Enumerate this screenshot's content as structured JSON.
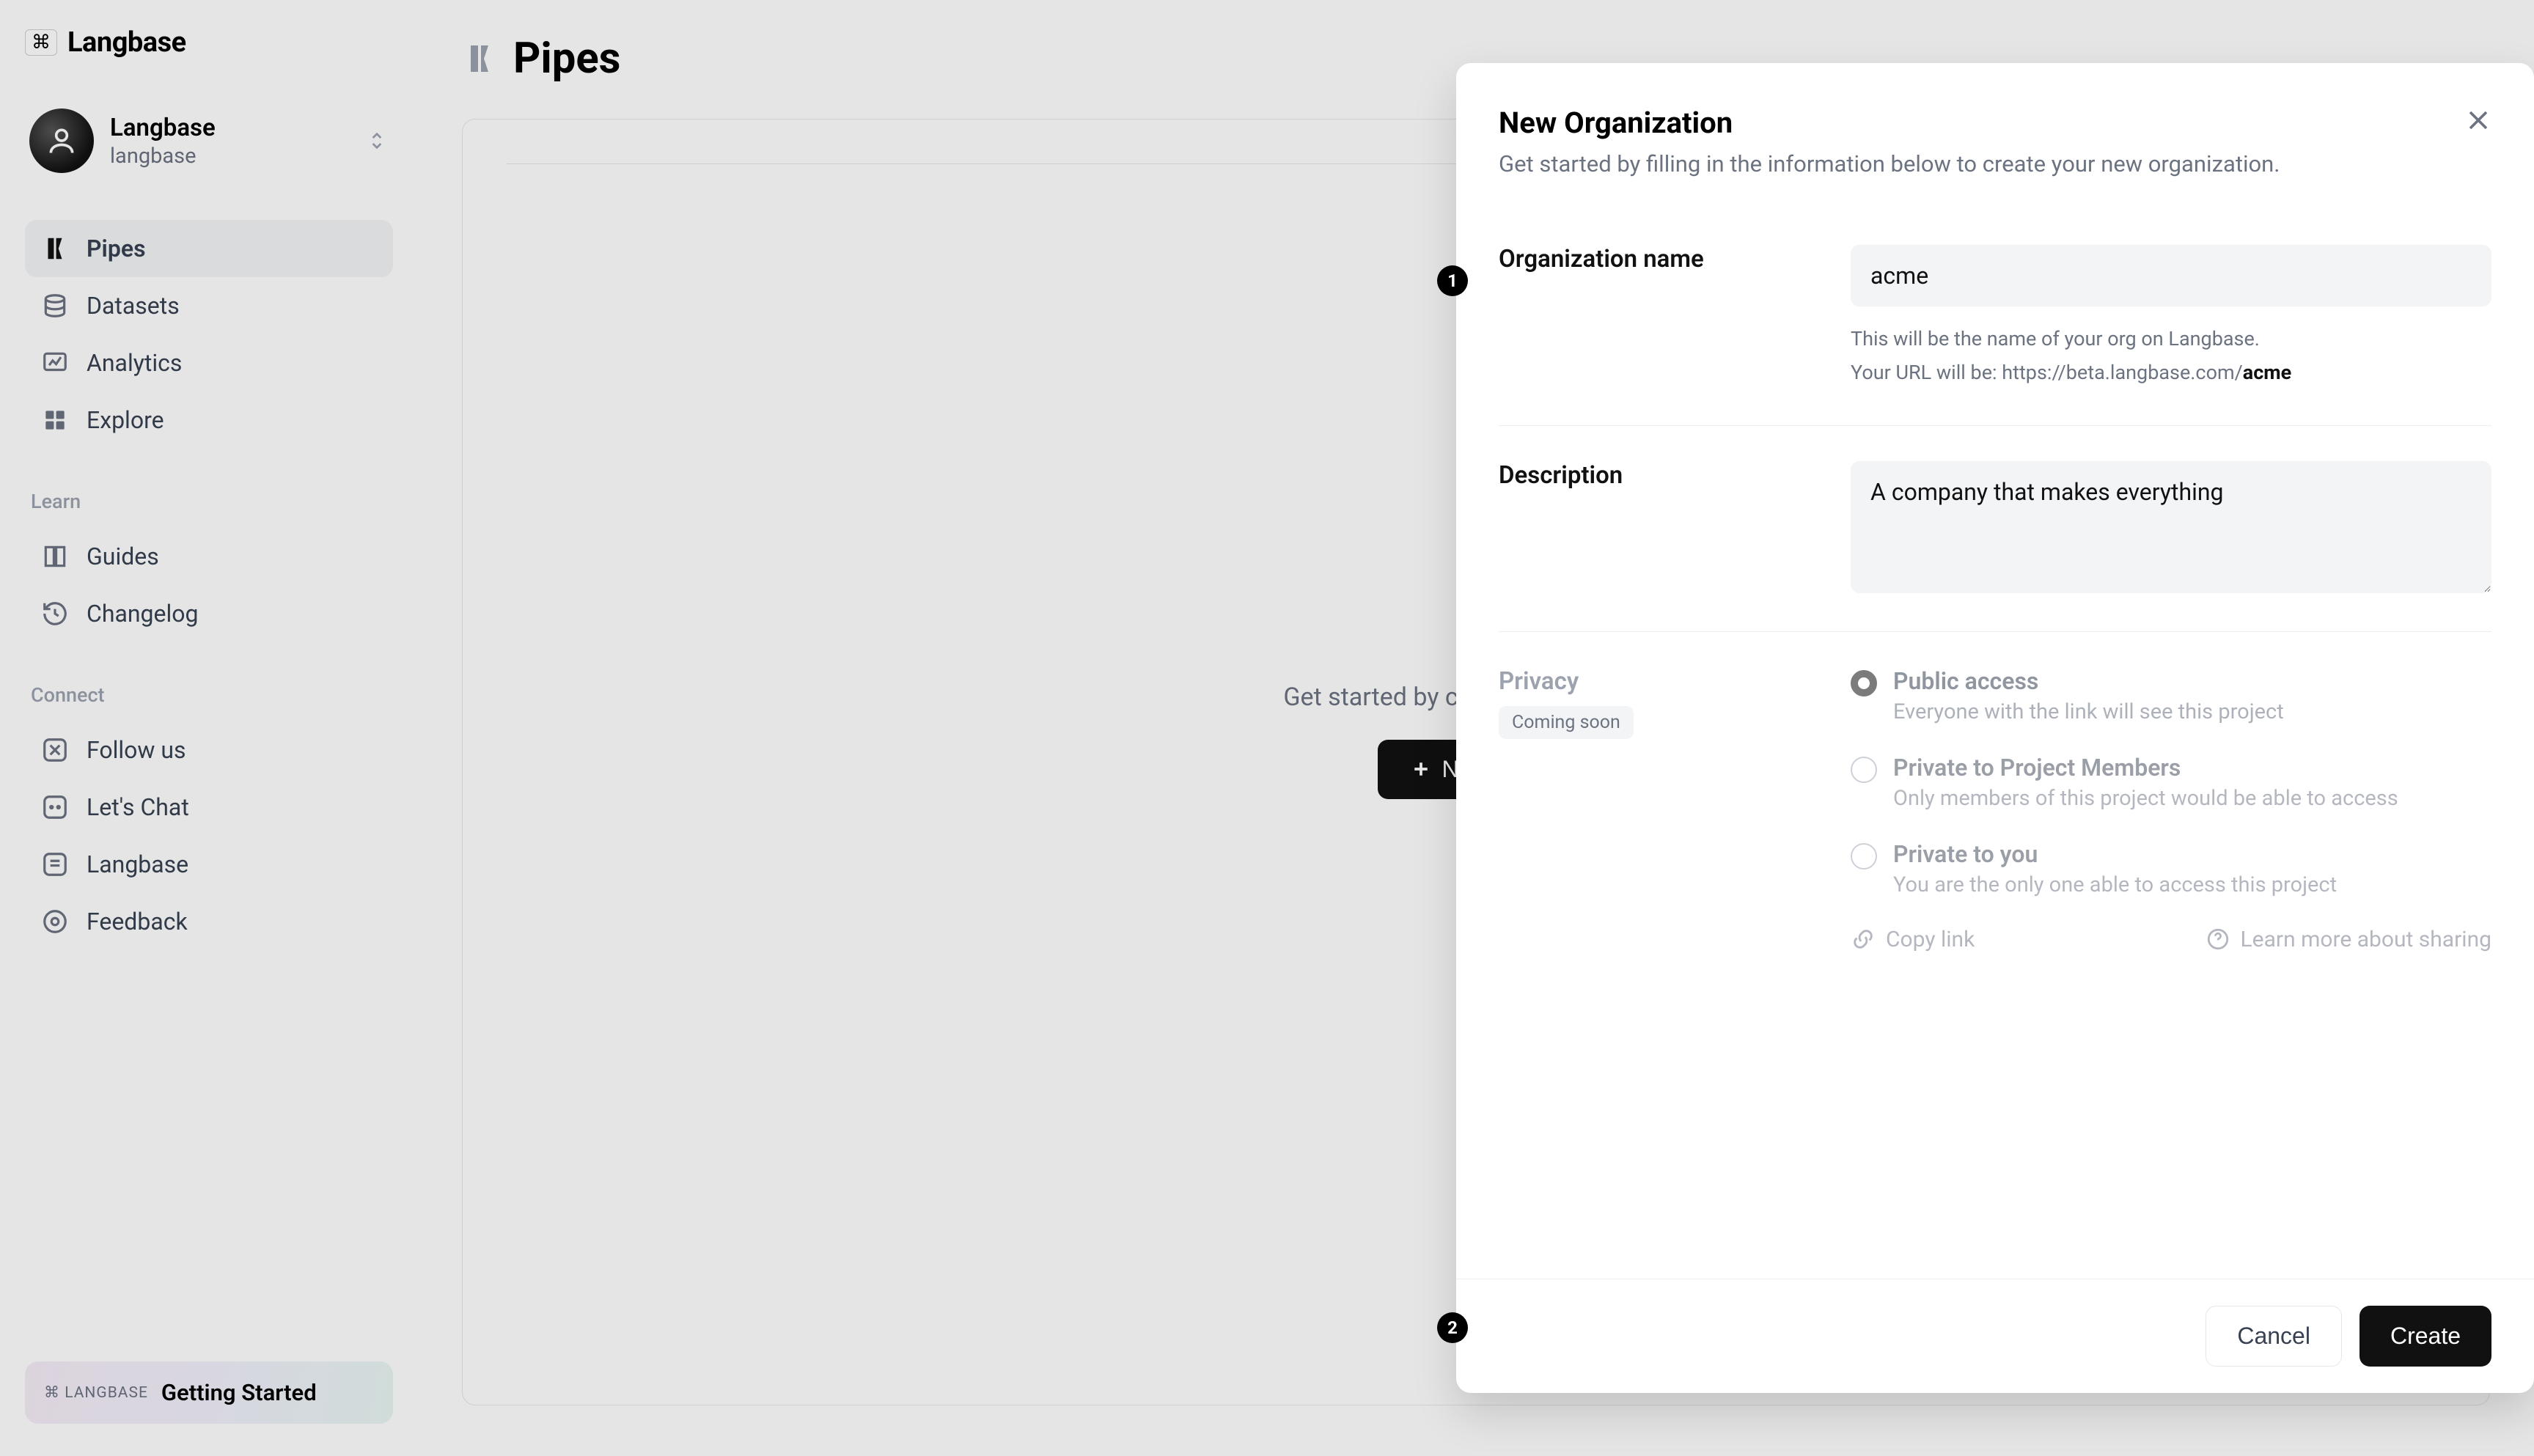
{
  "brand": {
    "symbol": "⌘",
    "name": "Langbase"
  },
  "org": {
    "name": "Langbase",
    "slug": "langbase"
  },
  "nav": {
    "main": [
      {
        "label": "Pipes",
        "active": true
      },
      {
        "label": "Datasets"
      },
      {
        "label": "Analytics"
      },
      {
        "label": "Explore"
      }
    ],
    "learn_heading": "Learn",
    "learn": [
      {
        "label": "Guides"
      },
      {
        "label": "Changelog"
      }
    ],
    "connect_heading": "Connect",
    "connect": [
      {
        "label": "Follow us"
      },
      {
        "label": "Let's Chat"
      },
      {
        "label": "Langbase"
      },
      {
        "label": "Feedback"
      }
    ]
  },
  "getting_started": {
    "badge": "⌘ LANGBASE",
    "text": "Getting Started"
  },
  "page": {
    "title": "Pipes",
    "empty_text": "Get started by creating a new Pipe.",
    "new_pipe_label": "New Pipe"
  },
  "modal": {
    "title": "New Organization",
    "subtitle": "Get started by filling in the information below to create your new organization.",
    "fields": {
      "org_name_label": "Organization name",
      "org_name_value": "acme",
      "org_name_help1": "This will be the name of your org on Langbase.",
      "org_name_help2_pre": "Your URL will be: https://beta.langbase.com/",
      "org_name_help2_value": "acme",
      "description_label": "Description",
      "description_value": "A company that makes everything",
      "privacy_label": "Privacy",
      "privacy_badge": "Coming soon",
      "privacy_options": [
        {
          "title": "Public access",
          "desc": "Everyone with the link will see this project",
          "selected": true
        },
        {
          "title": "Private to Project Members",
          "desc": "Only members of this project would be able to access",
          "selected": false
        },
        {
          "title": "Private to you",
          "desc": "You are the only one able to access this project",
          "selected": false
        }
      ],
      "copy_link": "Copy link",
      "learn_more": "Learn more about sharing"
    },
    "footer": {
      "cancel": "Cancel",
      "create": "Create"
    }
  },
  "markers": {
    "one": "1",
    "two": "2"
  }
}
